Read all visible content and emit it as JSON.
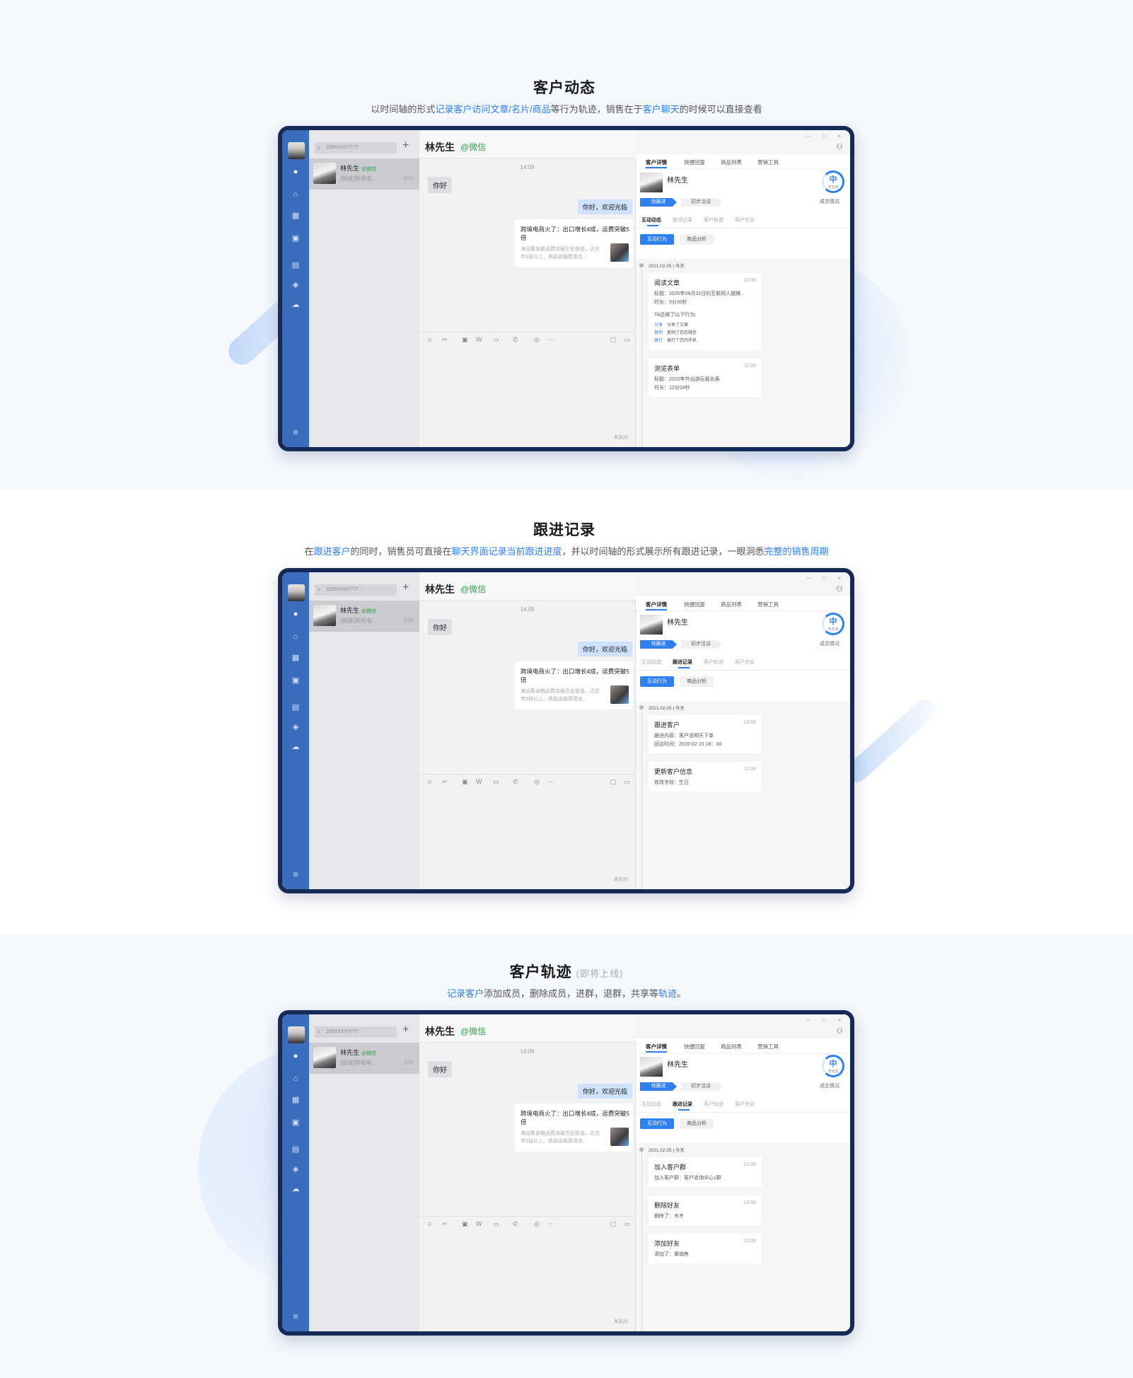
{
  "sections": [
    {
      "title": "客户动态",
      "soon": "",
      "subtitle_parts": [
        {
          "text": "以时间轴的形式",
          "hl": false
        },
        {
          "text": "记录客户访问文章/名片/商品",
          "hl": true
        },
        {
          "text": "等行为轨迹，销售在于",
          "hl": false
        },
        {
          "text": "客户聊天",
          "hl": true
        },
        {
          "text": "的时候可以直接查看",
          "hl": false
        }
      ],
      "active_subtab": 0,
      "events": [
        {
          "title": "阅读文章",
          "time": "12:08",
          "lines": [
            "标题：2020年06月31日的互联网人摆摊...",
            "时长：5分30秒"
          ],
          "extra_title": "TA还做了以下行为:",
          "extra": [
            {
              "tag": "分享",
              "text": "分享了文章"
            },
            {
              "tag": "复制",
              "text": "复制了您的微信"
            },
            {
              "tag": "拨打",
              "text": "拨打了您的手机"
            }
          ]
        },
        {
          "title": "浏览表单",
          "time": "11:08",
          "lines": [
            "标题：2020年外出游玩报名表",
            "时长：12分24秒"
          ],
          "extra_title": "",
          "extra": []
        }
      ]
    },
    {
      "title": "跟进记录",
      "soon": "",
      "subtitle_parts": [
        {
          "text": "在",
          "hl": false
        },
        {
          "text": "跟进客户",
          "hl": true
        },
        {
          "text": "的同时，销售员可直接在",
          "hl": false
        },
        {
          "text": "聊天界面记录当前跟进进度",
          "hl": true
        },
        {
          "text": "，并以时间轴的形式展示所有跟进记录，一眼洞悉",
          "hl": false
        },
        {
          "text": "完整的销售周期",
          "hl": true
        }
      ],
      "active_subtab": 1,
      "events": [
        {
          "title": "跟进客户",
          "time": "12:08",
          "lines": [
            "跟进内容：客户说明天下单",
            "回访时间：2020-02-15 18：00"
          ],
          "extra_title": "",
          "extra": []
        },
        {
          "title": "更新客户信息",
          "time": "11:08",
          "lines": [
            "修改字段：生日"
          ],
          "extra_title": "",
          "extra": []
        }
      ]
    },
    {
      "title": "客户轨迹",
      "soon": "(即将上线)",
      "subtitle_parts": [
        {
          "text": "记录客户",
          "hl": true
        },
        {
          "text": "添加成员，删除成员，进群，退群，共享等",
          "hl": false
        },
        {
          "text": "轨迹",
          "hl": true
        },
        {
          "text": "。",
          "hl": false
        }
      ],
      "active_subtab": 1,
      "events": [
        {
          "title": "加入客户群",
          "time": "12:08",
          "lines": [
            "加入客户群：客户咨询中心1群"
          ],
          "extra_title": "",
          "extra": []
        },
        {
          "title": "删除好友",
          "time": "12:08",
          "lines": [
            "删除了：冬冬"
          ],
          "extra_title": "",
          "extra": []
        },
        {
          "title": "添加好友",
          "time": "12:08",
          "lines": [
            "添加了：黄销售"
          ],
          "extra_title": "",
          "extra": []
        }
      ]
    }
  ],
  "app": {
    "search_placeholder": "搜索",
    "contact_name": "林先生",
    "contact_channel": "@微信",
    "contact_preview": "[链接]跨境电...",
    "contact_time": "刚刚",
    "chat_time": "14:09",
    "msg_in": "你好",
    "msg_out": "你好，欢迎光临",
    "card_title": "跨境电商火了：出口增长4成，运费突破5倍",
    "card_desc": "海运集装箱运费突破历史极值，达往年5倍以上，铁路运输费用也...",
    "send_label": "发送(S)",
    "win_controls": "－ □ ×",
    "right_tabs": [
      "客户详情",
      "快捷回复",
      "商品列表",
      "营销工具"
    ],
    "phone": "150XXXX7777",
    "level": "中",
    "level_sub": "意向度",
    "stages": [
      "待跟进",
      "初步洽谈",
      "成交情况"
    ],
    "sub_tabs": [
      "互动动态",
      "跟进记录",
      "客户轨迹",
      "客户信息"
    ],
    "btn_behavior": "互动行为",
    "btn_goods": "商品分析",
    "timeline_date": "2021.02.05 | 今天"
  },
  "icons": {
    "rail": [
      "chat-icon",
      "org-icon",
      "calendar-icon",
      "apps-icon",
      "doc-icon",
      "cube-icon",
      "cloud-icon"
    ],
    "toolbar": [
      "emoji-icon",
      "scissors-icon",
      "image-icon",
      "word-icon",
      "folder-icon",
      "phone-icon",
      "shield-icon",
      "more-icon"
    ]
  },
  "colors": {
    "accent": "#2e7ff0",
    "rail": "#3a6dbb",
    "frame": "#162a57",
    "wechat_green": "#2ba245"
  }
}
